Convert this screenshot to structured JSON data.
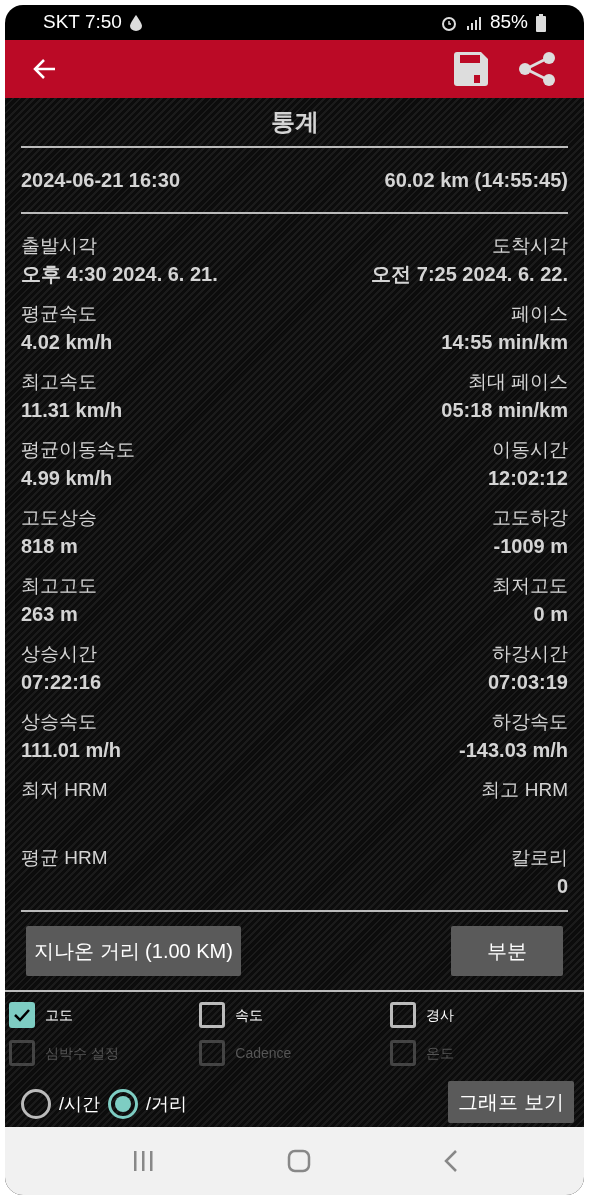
{
  "status_bar": {
    "carrier_time": "SKT 7:50",
    "battery": "85%"
  },
  "title": "통계",
  "summary": {
    "date": "2024-06-21 16:30",
    "distance": "60.02 km (14:55:45)"
  },
  "stats": [
    {
      "left": {
        "label": "출발시각",
        "value": "오후 4:30 2024. 6. 21."
      },
      "right": {
        "label": "도착시각",
        "value": "오전 7:25 2024. 6. 22."
      }
    },
    {
      "left": {
        "label": "평균속도",
        "value": "4.02 km/h"
      },
      "right": {
        "label": "페이스",
        "value": "14:55 min/km"
      }
    },
    {
      "left": {
        "label": "최고속도",
        "value": "11.31 km/h"
      },
      "right": {
        "label": "최대 페이스",
        "value": "05:18 min/km"
      }
    },
    {
      "left": {
        "label": "평균이동속도",
        "value": "4.99 km/h"
      },
      "right": {
        "label": "이동시간",
        "value": "12:02:12"
      }
    },
    {
      "left": {
        "label": "고도상승",
        "value": "818 m"
      },
      "right": {
        "label": "고도하강",
        "value": "-1009 m"
      }
    },
    {
      "left": {
        "label": "최고고도",
        "value": "263 m"
      },
      "right": {
        "label": "최저고도",
        "value": "0 m"
      }
    },
    {
      "left": {
        "label": "상승시간",
        "value": "07:22:16"
      },
      "right": {
        "label": "하강시간",
        "value": "07:03:19"
      }
    },
    {
      "left": {
        "label": "상승속도",
        "value": "111.01 m/h"
      },
      "right": {
        "label": "하강속도",
        "value": "-143.03 m/h"
      }
    },
    {
      "left": {
        "label": "최저 HRM"
      },
      "right": {
        "label": "최고 HRM"
      }
    },
    {
      "left": {
        "label": "평균 HRM"
      },
      "right": {
        "label": "칼로리",
        "value": "0"
      }
    }
  ],
  "buttons": [
    "지나온 거리 (1.00  KM)",
    "부분"
  ],
  "checkboxes": [
    {
      "label": "고도",
      "checked": true,
      "disabled": false
    },
    {
      "label": "속도",
      "checked": false,
      "disabled": false
    },
    {
      "label": "경사",
      "checked": false,
      "disabled": false
    },
    {
      "label": "심박수 설정",
      "checked": false,
      "disabled": true
    },
    {
      "label": "Cadence",
      "checked": false,
      "disabled": true
    },
    {
      "label": "온도",
      "checked": false,
      "disabled": true
    }
  ],
  "radios": [
    {
      "label": "/시간",
      "selected": false
    },
    {
      "label": "/거리",
      "selected": true
    }
  ],
  "graph_button": "그래프 보기"
}
